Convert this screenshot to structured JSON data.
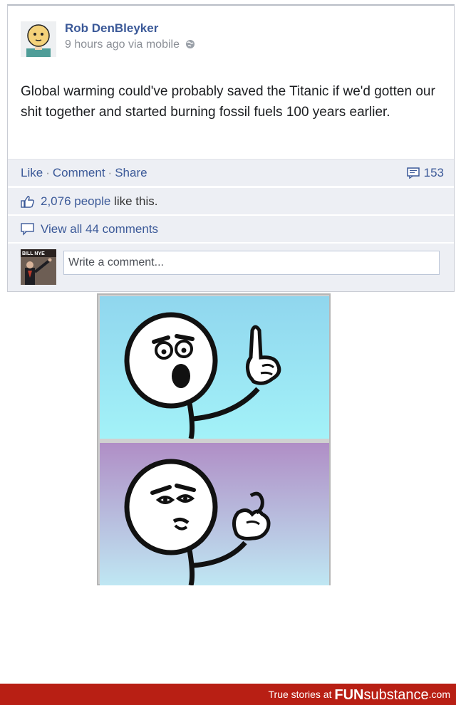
{
  "post": {
    "author": "Rob DenBleyker",
    "meta": "9 hours ago via mobile",
    "text": "Global warming could've probably saved the Titanic if we'd gotten our shit together and started burning fossil fuels 100 years earlier.",
    "actions": {
      "like": "Like",
      "comment": "Comment",
      "share": "Share",
      "separator": "·"
    },
    "comment_count": "153",
    "likes": {
      "count": "2,076 people",
      "suffix": " like this."
    },
    "view_comments": "View all 44 comments",
    "commenter_avatar_label": "BILL NYE",
    "comment_placeholder": "Write a comment..."
  },
  "footer": {
    "prefix": "True stories at ",
    "brand_bold": "FUN",
    "brand_rest": "substance",
    "suffix": ".com"
  },
  "colors": {
    "link_blue": "#3b5998",
    "bar_bg": "#edeff4",
    "footer_red": "#b81f14",
    "panel_top_bg": "#9fe6f2",
    "panel_bottom_bg_top": "#b08ec6",
    "panel_bottom_bg_bottom": "#bfe7f3"
  },
  "icons": [
    "globe-icon",
    "comment-count-icon",
    "thumbs-up-icon",
    "comments-icon"
  ]
}
